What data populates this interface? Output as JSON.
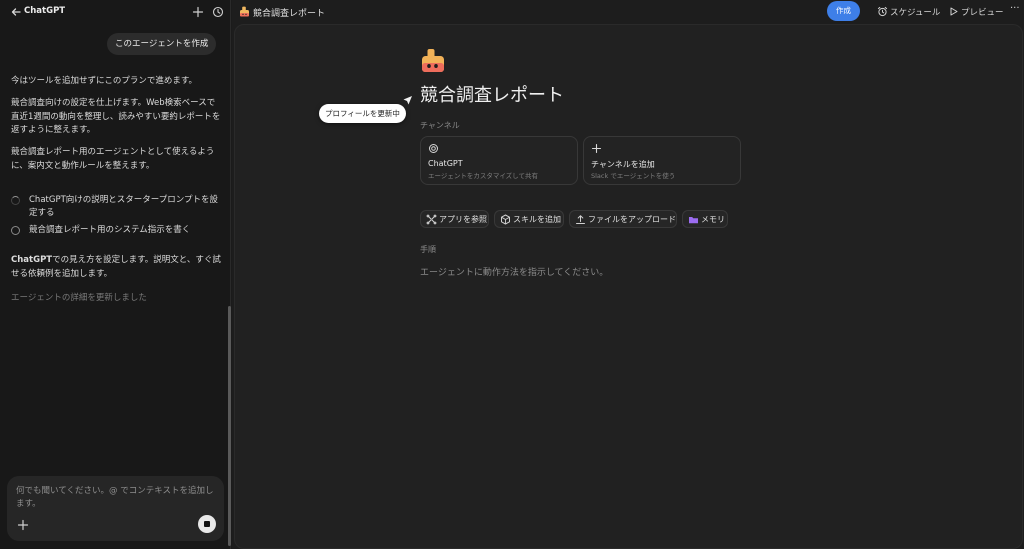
{
  "sidebar": {
    "app_title": "ChatGPT",
    "user_message": "このエージェントを作成",
    "assistant_paragraphs": [
      "今はツールを追加せずにこのプランで進めます。",
      "競合調査向けの設定を仕上げます。Web検索ベースで直近1週間の動向を整理し、読みやすい要約レポートを返すように整えます。",
      "競合調査レポート用のエージェントとして使えるように、案内文と動作ルールを整えます。"
    ],
    "tasks": [
      {
        "label": "ChatGPT向けの説明とスタータープロンプトを設定する",
        "state": "in-progress"
      },
      {
        "label": "競合調査レポート用のシステム指示を書く",
        "state": "pending"
      }
    ],
    "summary_bold": "ChatGPT",
    "summary_rest": "での見え方を設定します。説明文と、すぐ試せる依頼例を追加します。",
    "status_text": "エージェントの詳細を更新しました",
    "composer_placeholder": "何でも聞いてください。@ でコンテキストを追加します。"
  },
  "header": {
    "document_title": "競合調査レポート",
    "create_label": "作成",
    "schedule_label": "スケジュール",
    "preview_label": "プレビュー",
    "more_label": "···"
  },
  "editor": {
    "agent_name": "競合調査レポート",
    "channels_label": "チャンネル",
    "channels": [
      {
        "icon": "chatgpt-icon",
        "title": "ChatGPT",
        "subtitle": "エージェントをカスタマイズして共有"
      },
      {
        "icon": "plus-icon",
        "title": "チャンネルを追加",
        "subtitle": "Slack でエージェントを使う"
      }
    ],
    "tools": [
      {
        "icon": "apps-icon",
        "label": "アプリを参照"
      },
      {
        "icon": "skills-icon",
        "label": "スキルを追加"
      },
      {
        "icon": "upload-icon",
        "label": "ファイルをアップロード"
      },
      {
        "icon": "folder-icon",
        "label": "メモリ"
      }
    ],
    "instructions_label": "手順",
    "instructions_placeholder": "エージェントに動作方法を指示してください。",
    "tooltip": "プロフィールを更新中"
  },
  "colors": {
    "accent": "#3e7fe8",
    "panel": "#181818",
    "canvas": "#212121",
    "folder": "#9b6cf0"
  }
}
